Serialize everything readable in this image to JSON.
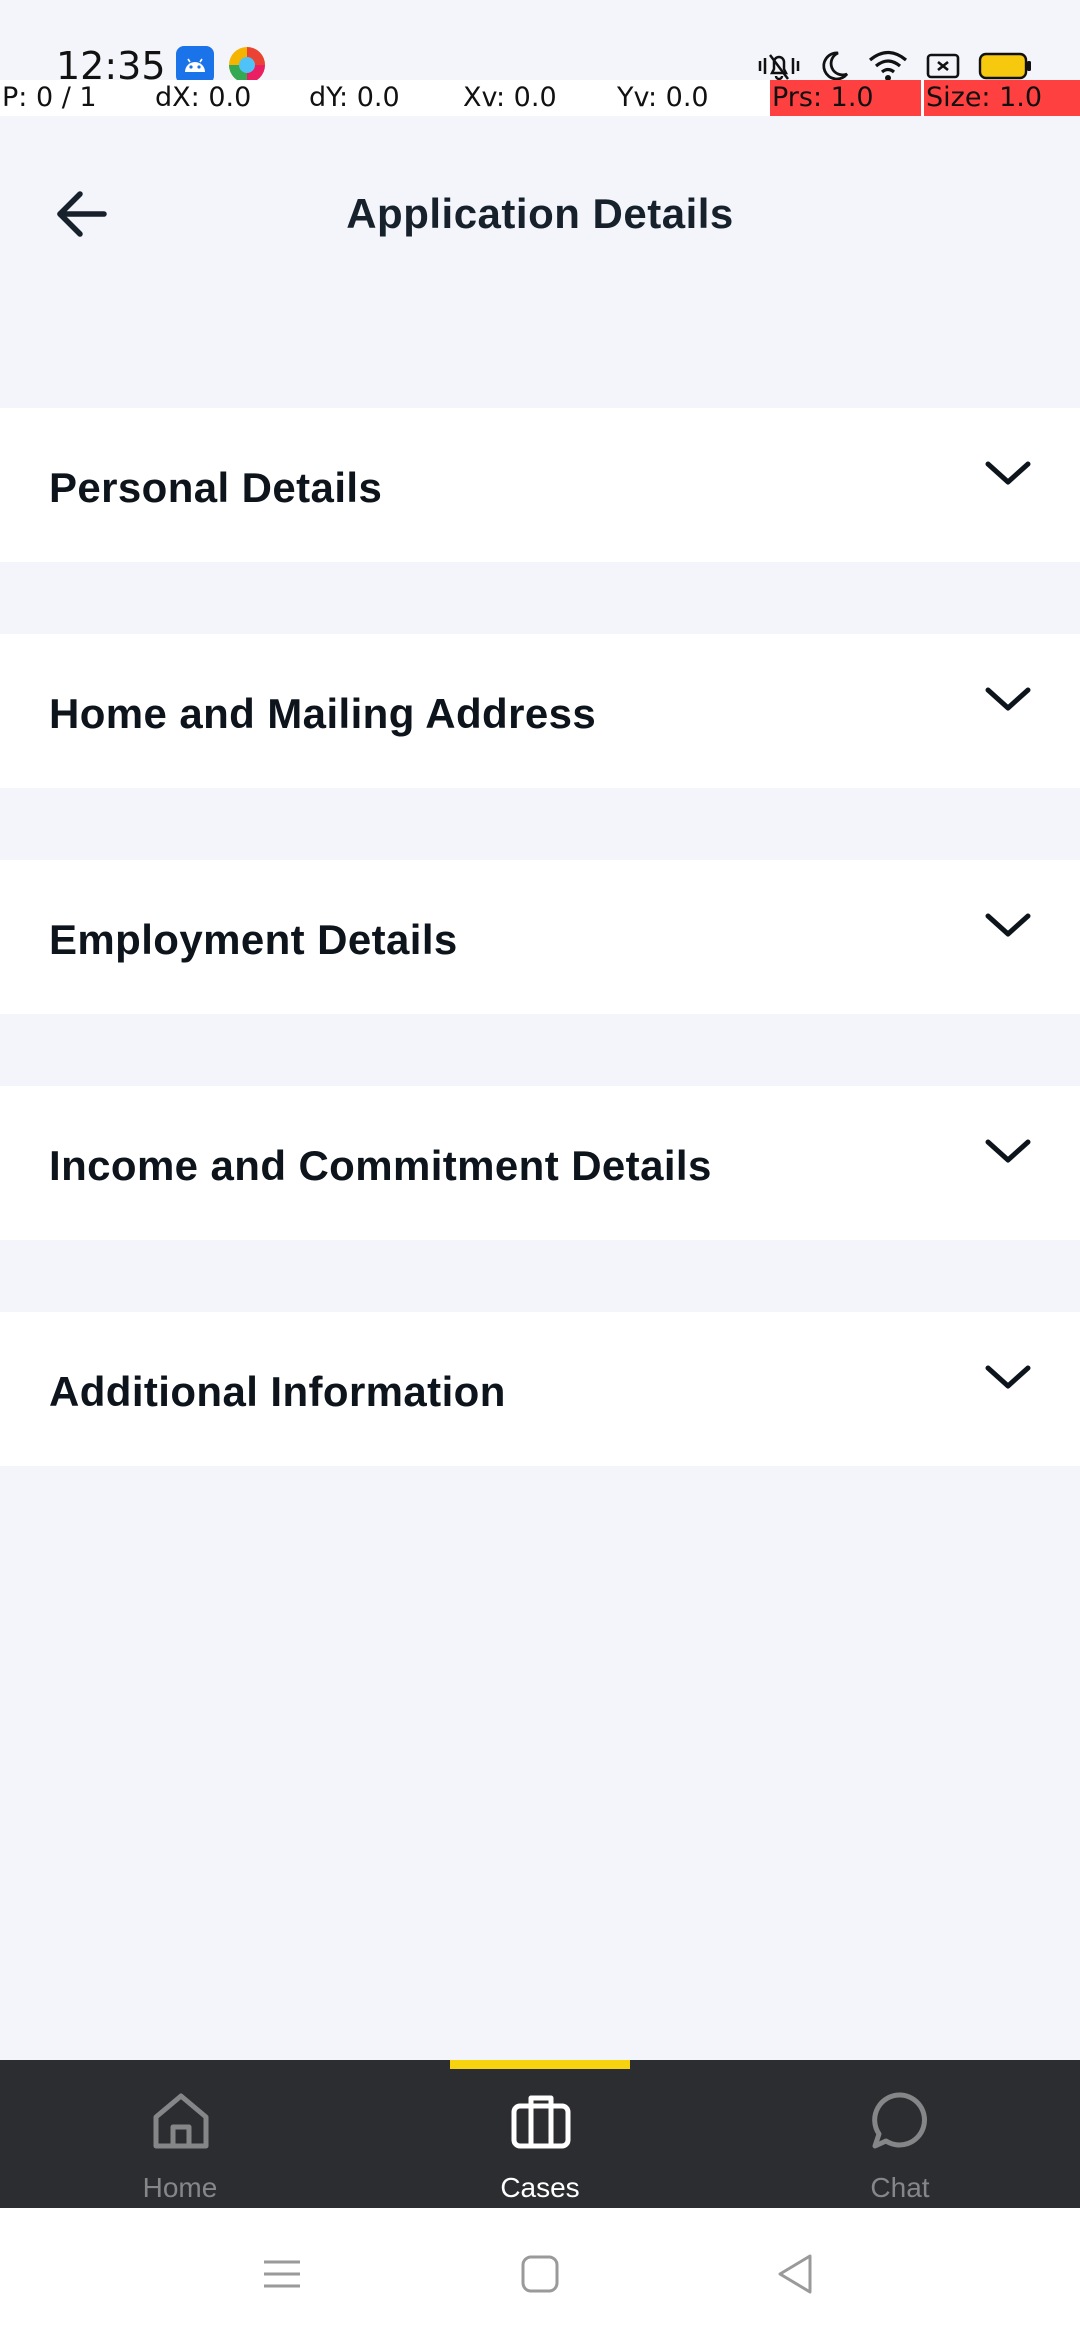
{
  "status_bar": {
    "time": "12:35",
    "icons": [
      "android-app-icon",
      "browser-app-icon",
      "mute-vibrate-icon",
      "do-not-disturb-icon",
      "wifi-icon",
      "screen-record-icon",
      "battery-icon"
    ]
  },
  "pointer_overlay": {
    "p": "P: 0 / 1",
    "dx": "dX: 0.0",
    "dy": "dY: 0.0",
    "xv": "Xv: 0.0",
    "yv": "Yv: 0.0",
    "prs": "Prs: 1.0",
    "size": "Size: 1.0"
  },
  "header": {
    "title": "Application Details"
  },
  "sections": [
    {
      "label": "Personal Details"
    },
    {
      "label": "Home and Mailing Address"
    },
    {
      "label": "Employment Details"
    },
    {
      "label": "Income and Commitment Details"
    },
    {
      "label": "Additional Information"
    }
  ],
  "bottom_nav": {
    "items": [
      {
        "label": "Home",
        "icon": "home-icon"
      },
      {
        "label": "Cases",
        "icon": "briefcase-icon",
        "active": true
      },
      {
        "label": "Chat",
        "icon": "chat-bubble-icon"
      }
    ]
  },
  "colors": {
    "background": "#f3f5fb",
    "card": "#ffffff",
    "nav_background": "#2c2d31",
    "nav_indicator": "#f6d20f",
    "text_primary": "#16212b"
  }
}
